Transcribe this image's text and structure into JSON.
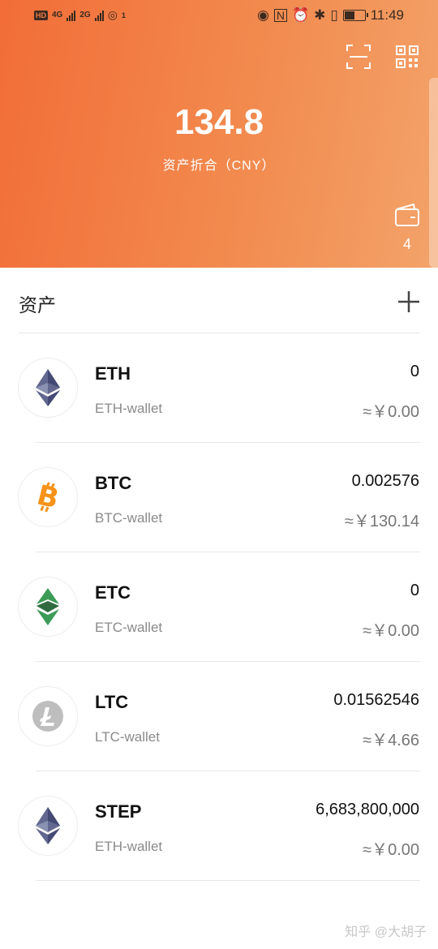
{
  "status_bar": {
    "left_badge": "HD",
    "network_1": "4G",
    "network_2": "2G",
    "hotspot_count": "1",
    "time": "11:49",
    "battery_level": 0.55,
    "icons": [
      "eye-icon",
      "nfc-icon",
      "alarm-icon",
      "bluetooth-icon",
      "vibrate-icon",
      "battery-icon"
    ]
  },
  "header": {
    "total_value": "134.8",
    "total_label": "资产折合（CNY）",
    "wallet_count": "4",
    "scan_icon": "scan-icon",
    "qr_icon": "qr-code-icon",
    "wallet_icon": "wallet-icon"
  },
  "assets": {
    "title": "资产",
    "add_icon": "plus-icon",
    "items": [
      {
        "symbol": "ETH",
        "wallet": "ETH-wallet",
        "amount": "0",
        "fiat": "≈￥0.00",
        "icon": "ethereum-icon",
        "color": "#62688f"
      },
      {
        "symbol": "BTC",
        "wallet": "BTC-wallet",
        "amount": "0.002576",
        "fiat": "≈￥130.14",
        "icon": "bitcoin-icon",
        "color": "#f7931a"
      },
      {
        "symbol": "ETC",
        "wallet": "ETC-wallet",
        "amount": "0",
        "fiat": "≈￥0.00",
        "icon": "ethereum-classic-icon",
        "color": "#3b9b57"
      },
      {
        "symbol": "LTC",
        "wallet": "LTC-wallet",
        "amount": "0.01562546",
        "fiat": "≈￥4.66",
        "icon": "litecoin-icon",
        "color": "#bebebe"
      },
      {
        "symbol": "STEP",
        "wallet": "ETH-wallet",
        "amount": "6,683,800,000",
        "fiat": "≈￥0.00",
        "icon": "ethereum-icon",
        "color": "#62688f"
      }
    ]
  },
  "watermark": "知乎 @大胡子",
  "colors": {
    "header_start": "#f26d38",
    "header_end": "#f3a36a",
    "primary_text": "#111111",
    "secondary_text": "#8a8a8a"
  }
}
